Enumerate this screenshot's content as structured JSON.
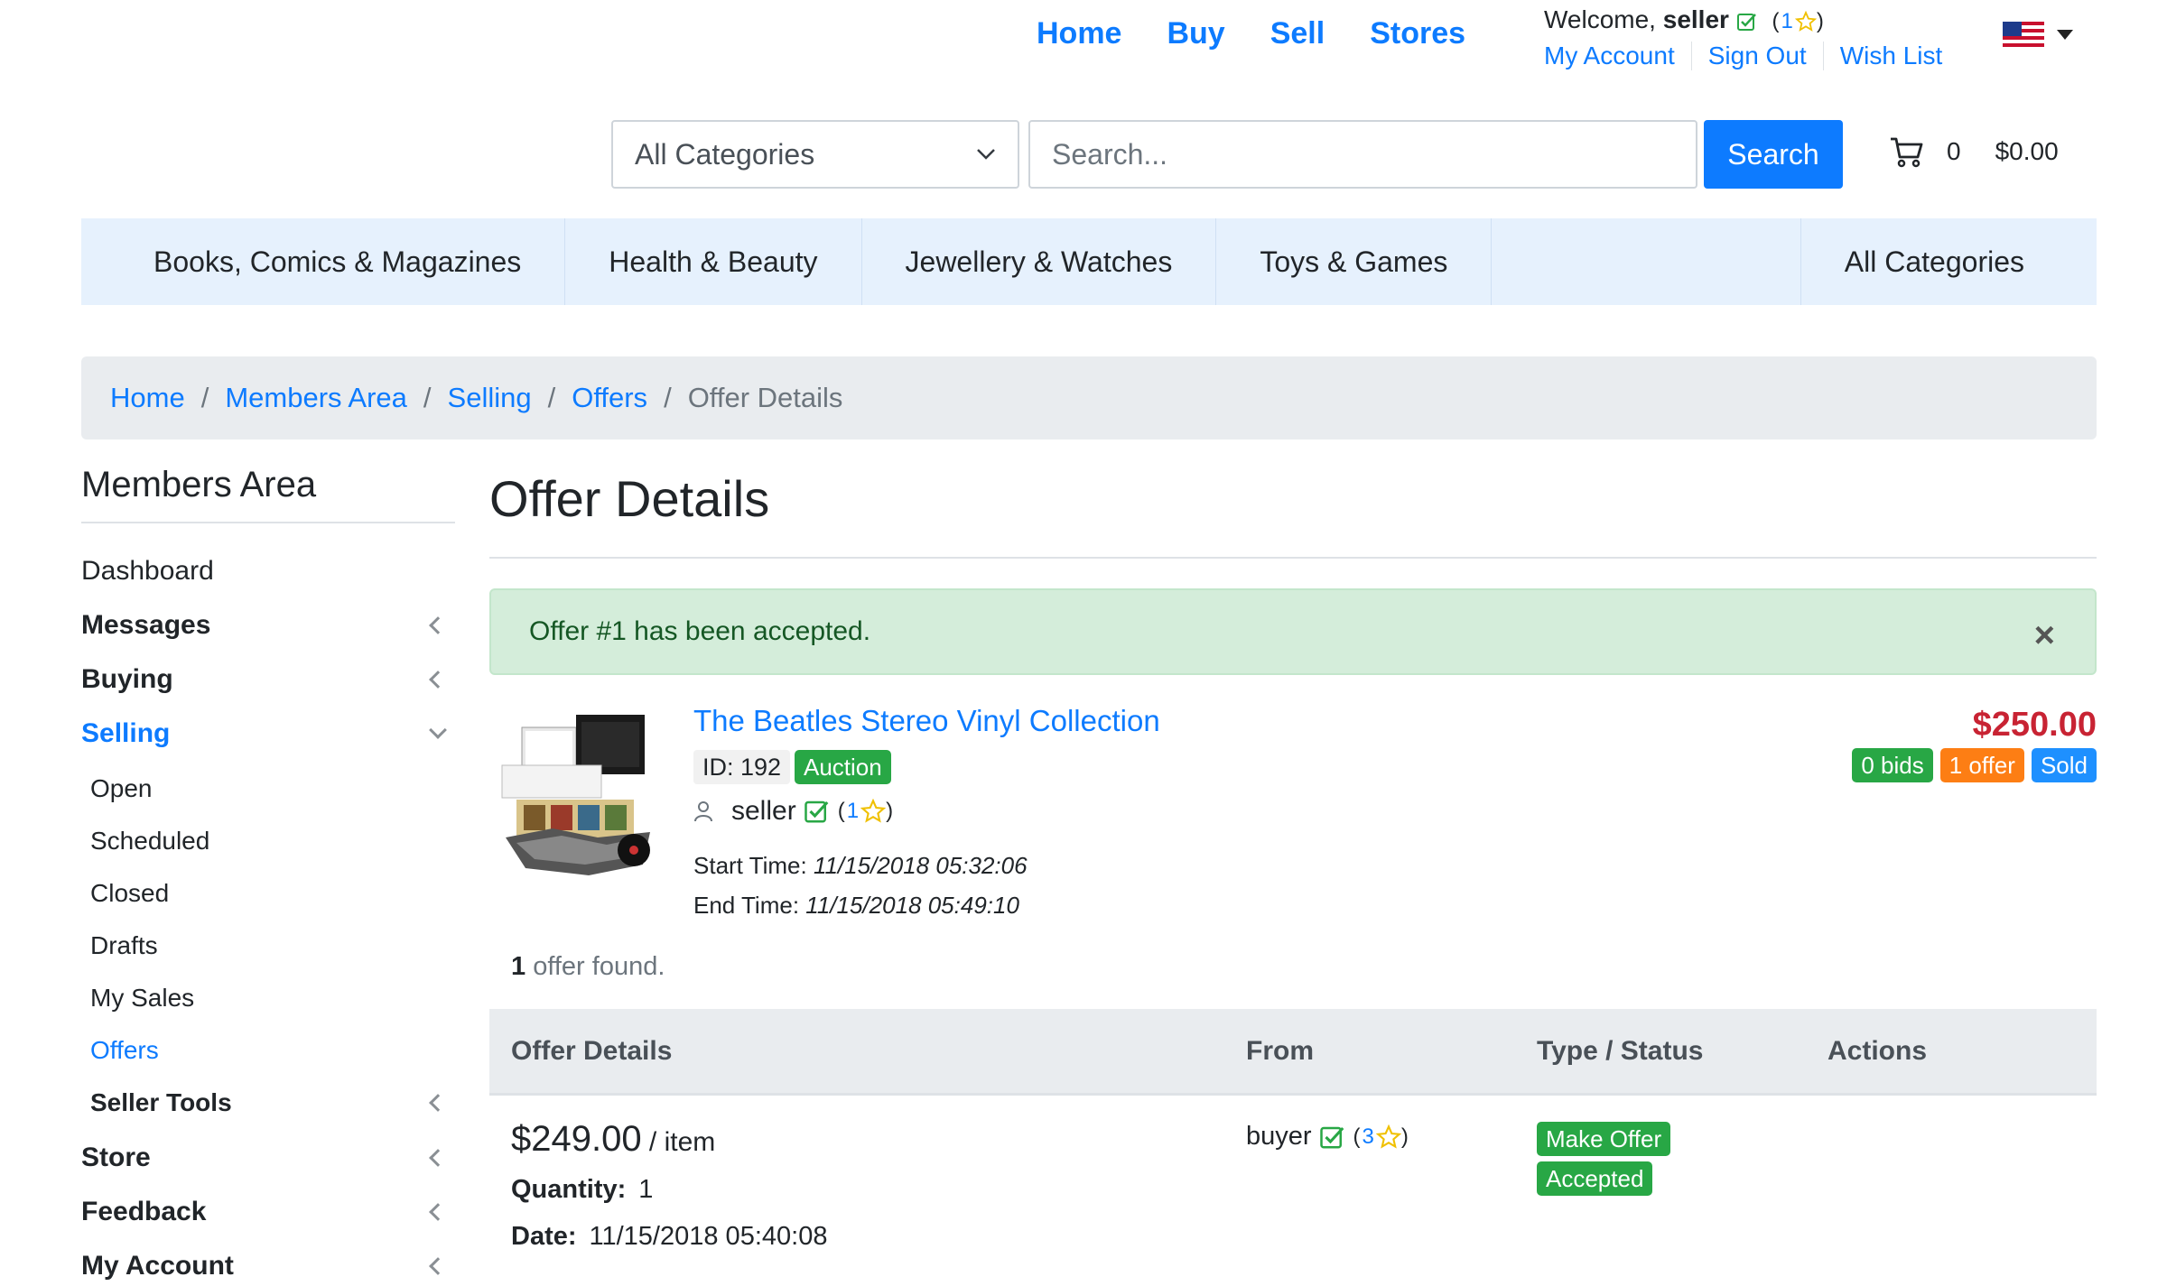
{
  "header": {
    "nav": [
      "Home",
      "Buy",
      "Sell",
      "Stores"
    ],
    "welcome_prefix": "Welcome, ",
    "username": "seller",
    "user_rating": "1",
    "links": [
      "My Account",
      "Sign Out",
      "Wish List"
    ],
    "flag_icon": "us-flag-icon"
  },
  "search": {
    "category": "All Categories",
    "placeholder": "Search...",
    "button": "Search"
  },
  "cart": {
    "count": "0",
    "total": "$0.00"
  },
  "categories": [
    "Books, Comics & Magazines",
    "Health & Beauty",
    "Jewellery & Watches",
    "Toys & Games",
    "All Categories"
  ],
  "breadcrumb": [
    "Home",
    "Members Area",
    "Selling",
    "Offers"
  ],
  "breadcrumb_active": "Offer Details",
  "sidebar": {
    "title": "Members Area",
    "items": {
      "dashboard": "Dashboard",
      "messages": "Messages",
      "buying": "Buying",
      "selling": "Selling",
      "open": "Open",
      "scheduled": "Scheduled",
      "closed": "Closed",
      "drafts": "Drafts",
      "my_sales": "My Sales",
      "offers": "Offers",
      "seller_tools": "Seller Tools",
      "store": "Store",
      "feedback": "Feedback",
      "my_account": "My Account"
    }
  },
  "page": {
    "title": "Offer Details",
    "alert": "Offer #1 has been accepted.",
    "alert_close": "×"
  },
  "listing": {
    "title": "The Beatles Stereo Vinyl Collection",
    "id_label": "ID: 192",
    "type_badge": "Auction",
    "seller": "seller",
    "seller_rating": "1",
    "start_label": "Start Time:",
    "start_time": "11/15/2018 05:32:06",
    "end_label": "End Time:",
    "end_time": "11/15/2018 05:49:10",
    "price": "$250.00",
    "bids": "0 bids",
    "offers": "1 offer",
    "status": "Sold"
  },
  "offers_table": {
    "found_count": "1",
    "found_text": " offer found.",
    "headers": [
      "Offer Details",
      "From",
      "Type / Status",
      "Actions"
    ],
    "row": {
      "price": "$249.00",
      "unit": " / item",
      "qty_label": "Quantity:",
      "qty": "1",
      "date_label": "Date:",
      "date": "11/15/2018 05:40:08",
      "from": "buyer",
      "from_rating": "3",
      "type": "Make Offer",
      "status": "Accepted"
    }
  },
  "colors": {
    "primary": "#0d7bff",
    "success": "#28a745",
    "warning": "#fd7e14",
    "info": "#1e90ff",
    "danger": "#c82333"
  }
}
